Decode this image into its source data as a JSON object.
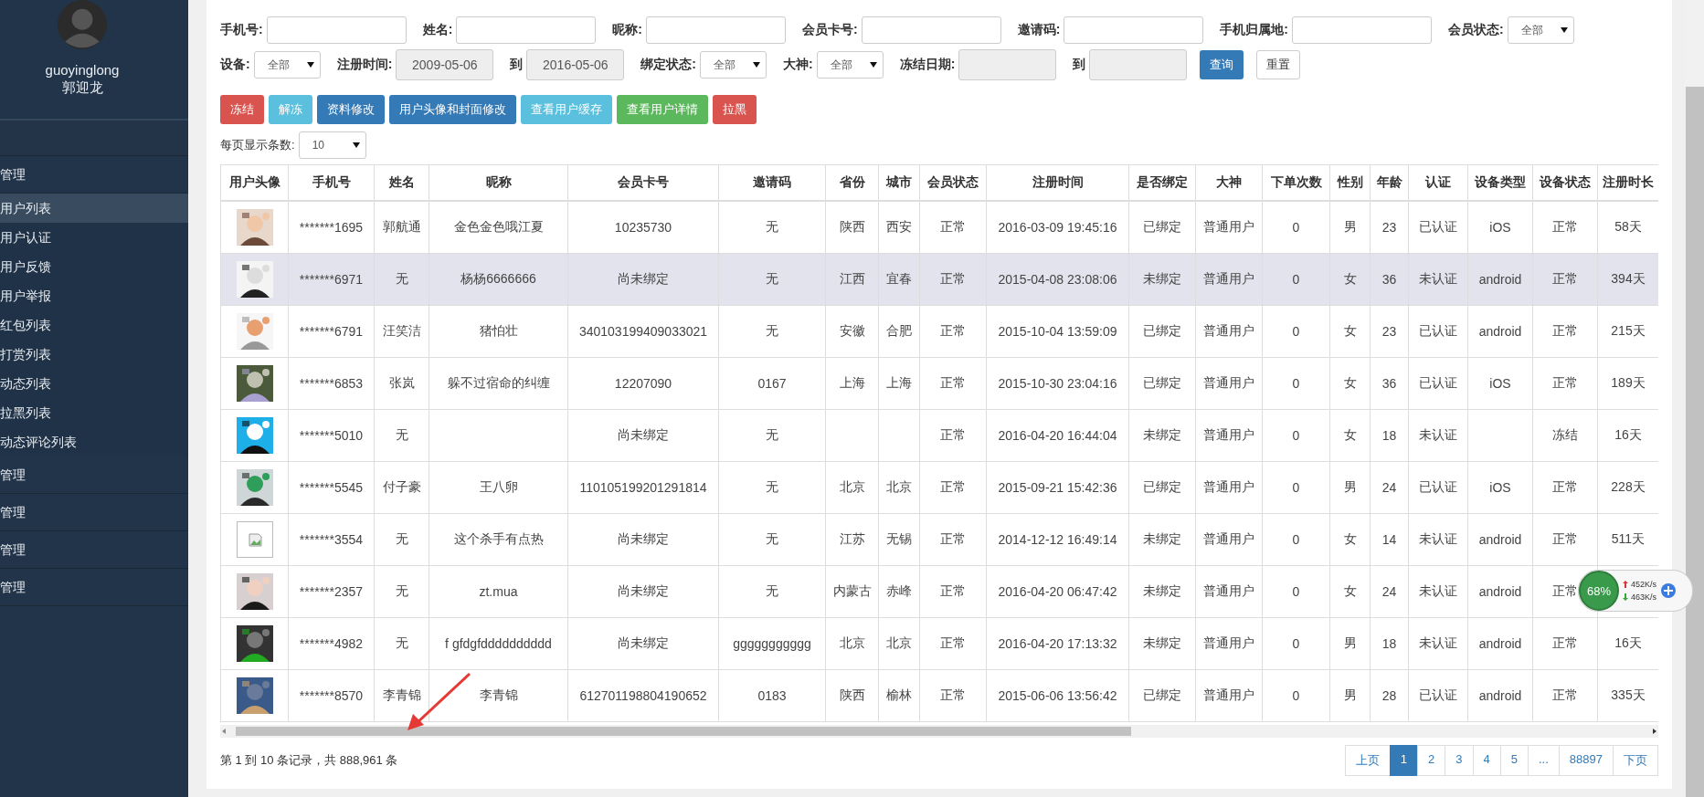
{
  "sidebar": {
    "username": "guoyinglong",
    "name": "郭迎龙",
    "groups": [
      {
        "label": "管理",
        "children": [
          {
            "label": "用户列表",
            "selected": true
          },
          {
            "label": "用户认证",
            "selected": false
          },
          {
            "label": "用户反馈",
            "selected": false
          },
          {
            "label": "用户举报",
            "selected": false
          },
          {
            "label": "红包列表",
            "selected": false
          },
          {
            "label": "打赏列表",
            "selected": false
          },
          {
            "label": "动态列表",
            "selected": false
          },
          {
            "label": "拉黑列表",
            "selected": false
          },
          {
            "label": "动态评论列表",
            "selected": false
          }
        ]
      },
      {
        "label": "管理"
      },
      {
        "label": "管理"
      },
      {
        "label": "管理"
      },
      {
        "label": "管理"
      }
    ]
  },
  "filters": [
    [
      {
        "label": "手机号:",
        "kind": "input"
      },
      {
        "label": "姓名:",
        "kind": "input"
      },
      {
        "label": "昵称:",
        "kind": "input"
      },
      {
        "label": "会员卡号:",
        "kind": "input"
      },
      {
        "label": "邀请码:",
        "kind": "input"
      },
      {
        "label": "手机归属地:",
        "kind": "input"
      },
      {
        "label": "会员状态:",
        "kind": "select",
        "value": "全部"
      }
    ],
    [
      {
        "label": "设备:",
        "kind": "select",
        "value": "全部"
      },
      {
        "label": "注册时间:",
        "kind": "date",
        "value": "2009-05-06"
      },
      {
        "label": "到",
        "kind": "date",
        "value": "2016-05-06"
      },
      {
        "label": "绑定状态:",
        "kind": "select",
        "value": "全部"
      },
      {
        "label": "大神:",
        "kind": "select",
        "value": "全部"
      },
      {
        "label": "冻结日期:",
        "kind": "date"
      },
      {
        "label": "到",
        "kind": "date"
      },
      {
        "label": "查询",
        "kind": "primary"
      },
      {
        "label": "重置",
        "kind": "default"
      }
    ]
  ],
  "actions": [
    {
      "label": "冻结",
      "kind": "danger"
    },
    {
      "label": "解冻",
      "kind": "info"
    },
    {
      "label": "资料修改",
      "kind": "primary"
    },
    {
      "label": "用户头像和封面修改",
      "kind": "primary"
    },
    {
      "label": "查看用户缓存",
      "kind": "info"
    },
    {
      "label": "查看用户详情",
      "kind": "success"
    },
    {
      "label": "拉黑",
      "kind": "danger"
    }
  ],
  "page_size": {
    "label": "每页显示条数:",
    "value": "10"
  },
  "table": {
    "columns": [
      "用户头像",
      "手机号",
      "姓名",
      "昵称",
      "会员卡号",
      "邀请码",
      "省份",
      "城市",
      "会员状态",
      "注册时间",
      "是否绑定",
      "大神",
      "下单次数",
      "性别",
      "年龄",
      "认证",
      "设备类型",
      "设备状态",
      "注册时长"
    ],
    "rows": [
      {
        "selected": false,
        "cells": [
          {
            "kind": "picture"
          },
          "*******1695",
          "郭航通",
          "金色金色哦江夏",
          "10235730",
          "无",
          "陕西",
          "西安",
          "正常",
          "2016-03-09 19:45:16",
          "已绑定",
          "普通用户",
          "0",
          "男",
          "23",
          "已认证",
          "iOS",
          "正常",
          "58天"
        ]
      },
      {
        "selected": true,
        "cells": [
          {
            "kind": "picture"
          },
          "*******6971",
          "无",
          "杨杨6666666",
          "尚未绑定",
          "无",
          "江西",
          "宜春",
          "正常",
          "2015-04-08 23:08:06",
          "未绑定",
          "普通用户",
          "0",
          "女",
          "36",
          "未认证",
          "android",
          "正常",
          "394天"
        ]
      },
      {
        "selected": false,
        "cells": [
          {
            "kind": "picture"
          },
          "*******6791",
          "汪笑洁",
          "猪怕壮",
          "340103199409033021",
          "无",
          "安徽",
          "合肥",
          "正常",
          "2015-10-04 13:59:09",
          "已绑定",
          "普通用户",
          "0",
          "女",
          "23",
          "已认证",
          "android",
          "正常",
          "215天"
        ]
      },
      {
        "selected": false,
        "cells": [
          {
            "kind": "picture"
          },
          "*******6853",
          "张岚",
          "躲不过宿命的纠缠",
          "12207090",
          "0167",
          "上海",
          "上海",
          "正常",
          "2015-10-30 23:04:16",
          "已绑定",
          "普通用户",
          "0",
          "女",
          "36",
          "已认证",
          "iOS",
          "正常",
          "189天"
        ]
      },
      {
        "selected": false,
        "cells": [
          {
            "kind": "picture"
          },
          "*******5010",
          "无",
          null,
          "尚未绑定",
          "无",
          null,
          null,
          "正常",
          "2016-04-20 16:44:04",
          "未绑定",
          "普通用户",
          "0",
          "女",
          "18",
          "未认证",
          null,
          "冻结",
          "16天"
        ]
      },
      {
        "selected": false,
        "cells": [
          {
            "kind": "picture"
          },
          "*******5545",
          "付子豪",
          "王八卵",
          "110105199201291814",
          "无",
          "北京",
          "北京",
          "正常",
          "2015-09-21 15:42:36",
          "已绑定",
          "普通用户",
          "0",
          "男",
          "24",
          "已认证",
          "iOS",
          "正常",
          "228天"
        ]
      },
      {
        "selected": false,
        "cells": [
          {
            "kind": "broken"
          },
          "*******3554",
          "无",
          "这个杀手有点热",
          "尚未绑定",
          "无",
          "江苏",
          "无锡",
          "正常",
          "2014-12-12 16:49:14",
          "未绑定",
          "普通用户",
          "0",
          "女",
          "14",
          "未认证",
          "android",
          "正常",
          "511天"
        ]
      },
      {
        "selected": false,
        "cells": [
          {
            "kind": "picture"
          },
          "*******2357",
          "无",
          "zt.mua",
          "尚未绑定",
          "无",
          "内蒙古",
          "赤峰",
          "正常",
          "2016-04-20 06:47:42",
          "未绑定",
          "普通用户",
          "0",
          "女",
          "24",
          "未认证",
          "android",
          "正常",
          null
        ]
      },
      {
        "selected": false,
        "cells": [
          {
            "kind": "picture"
          },
          "*******4982",
          "无",
          "f gfdgfdddddddddd",
          "尚未绑定",
          "ggggggggggg",
          "北京",
          "北京",
          "正常",
          "2016-04-20 17:13:32",
          "未绑定",
          "普通用户",
          "0",
          "男",
          "18",
          "未认证",
          "android",
          "正常",
          "16天"
        ]
      },
      {
        "selected": false,
        "cells": [
          {
            "kind": "picture"
          },
          "*******8570",
          "李青锦",
          "李青锦",
          "612701198804190652",
          "0183",
          "陕西",
          "榆林",
          "正常",
          "2015-06-06 13:56:42",
          "已绑定",
          "普通用户",
          "0",
          "男",
          "28",
          "已认证",
          "android",
          "正常",
          "335天"
        ]
      }
    ]
  },
  "footer": "第 1 到 10 条记录，共 888,961 条",
  "pagination": [
    {
      "label": "上页",
      "selected": false
    },
    {
      "label": "1",
      "selected": true
    },
    {
      "label": "2",
      "selected": false
    },
    {
      "label": "3",
      "selected": false
    },
    {
      "label": "4",
      "selected": false
    },
    {
      "label": "5",
      "selected": false
    },
    {
      "label": "...",
      "selected": false
    },
    {
      "label": "88897",
      "selected": false
    },
    {
      "label": "下页",
      "selected": false
    }
  ],
  "speed_widget": {
    "percent": "68%",
    "upload": "452K/s",
    "download": "463K/s"
  }
}
